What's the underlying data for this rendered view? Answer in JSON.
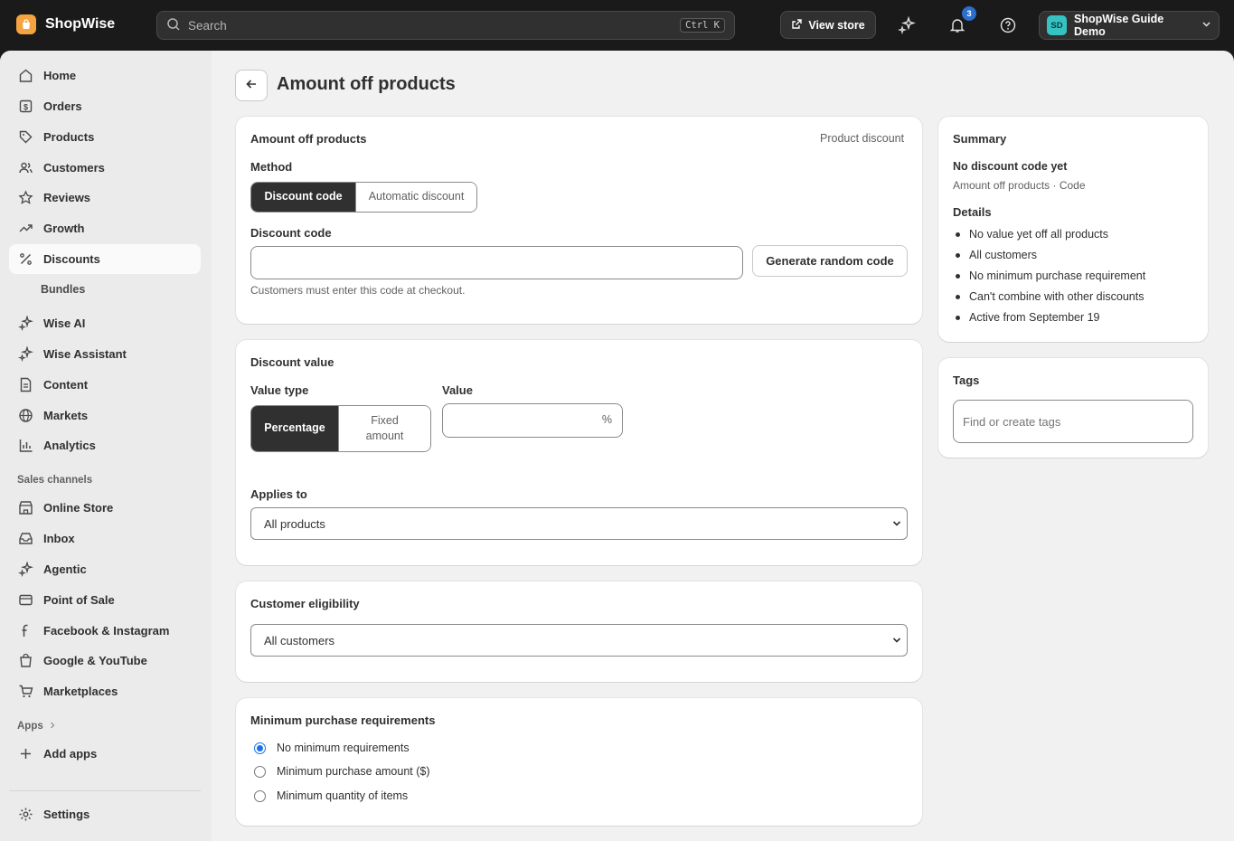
{
  "topbar": {
    "brand": "ShopWise",
    "search_placeholder": "Search",
    "search_shortcut": "Ctrl K",
    "view_store": "View store",
    "notification_count": "3",
    "account_initials": "SD",
    "account_name": "ShopWise Guide Demo"
  },
  "sidebar": {
    "items": [
      {
        "label": "Home",
        "icon": "home-icon"
      },
      {
        "label": "Orders",
        "icon": "orders-icon"
      },
      {
        "label": "Products",
        "icon": "tag-icon"
      },
      {
        "label": "Customers",
        "icon": "people-icon"
      },
      {
        "label": "Reviews",
        "icon": "star-icon"
      },
      {
        "label": "Growth",
        "icon": "trend-icon"
      },
      {
        "label": "Discounts",
        "icon": "percent-icon"
      },
      {
        "label": "Wise AI",
        "icon": "sparkle-icon"
      },
      {
        "label": "Wise Assistant",
        "icon": "sparkle-icon"
      },
      {
        "label": "Content",
        "icon": "document-icon"
      },
      {
        "label": "Markets",
        "icon": "globe-icon"
      },
      {
        "label": "Analytics",
        "icon": "bar-chart-icon"
      }
    ],
    "sub_item": "Bundles",
    "sales_channels_heading": "Sales channels",
    "channels": [
      {
        "label": "Online Store",
        "icon": "store-icon"
      },
      {
        "label": "Inbox",
        "icon": "inbox-icon"
      },
      {
        "label": "Agentic",
        "icon": "sparkle-icon"
      },
      {
        "label": "Point of Sale",
        "icon": "pos-icon"
      },
      {
        "label": "Facebook & Instagram",
        "icon": "facebook-icon"
      },
      {
        "label": "Google & YouTube",
        "icon": "bag-icon"
      },
      {
        "label": "Marketplaces",
        "icon": "cart-icon"
      }
    ],
    "apps_heading": "Apps",
    "add_apps": "Add apps",
    "settings": "Settings"
  },
  "page": {
    "title": "Amount off products"
  },
  "method_card": {
    "title": "Amount off products",
    "type_label": "Product discount",
    "method_label": "Method",
    "method_options": [
      "Discount code",
      "Automatic discount"
    ],
    "method_selected": "Discount code",
    "code_label": "Discount code",
    "code_value": "",
    "generate_button": "Generate random code",
    "help_text": "Customers must enter this code at checkout."
  },
  "value_card": {
    "title": "Discount value",
    "value_type_label": "Value type",
    "value_type_options": [
      "Percentage",
      "Fixed amount"
    ],
    "value_type_selected": "Percentage",
    "value_label": "Value",
    "value": "",
    "value_suffix": "%",
    "applies_to_label": "Applies to",
    "applies_to_value": "All products"
  },
  "eligibility_card": {
    "title": "Customer eligibility",
    "value": "All customers"
  },
  "minimum_card": {
    "title": "Minimum purchase requirements",
    "options": [
      "No minimum requirements",
      "Minimum purchase amount ($)",
      "Minimum quantity of items"
    ],
    "selected_index": 0
  },
  "summary": {
    "title": "Summary",
    "code_status": "No discount code yet",
    "subtitle": "Amount off products · Code",
    "details_label": "Details",
    "details": [
      "No value yet off all products",
      "All customers",
      "No minimum purchase requirement",
      "Can't combine with other discounts",
      "Active from September 19"
    ]
  },
  "tags": {
    "title": "Tags",
    "placeholder": "Find or create tags"
  },
  "colors": {
    "topbar_bg": "#1a1a1a",
    "brand_orange": "#f4a340",
    "selected_segment": "#303030",
    "notification_blue": "#2c6ecb",
    "radio_blue": "#1a73e8"
  }
}
